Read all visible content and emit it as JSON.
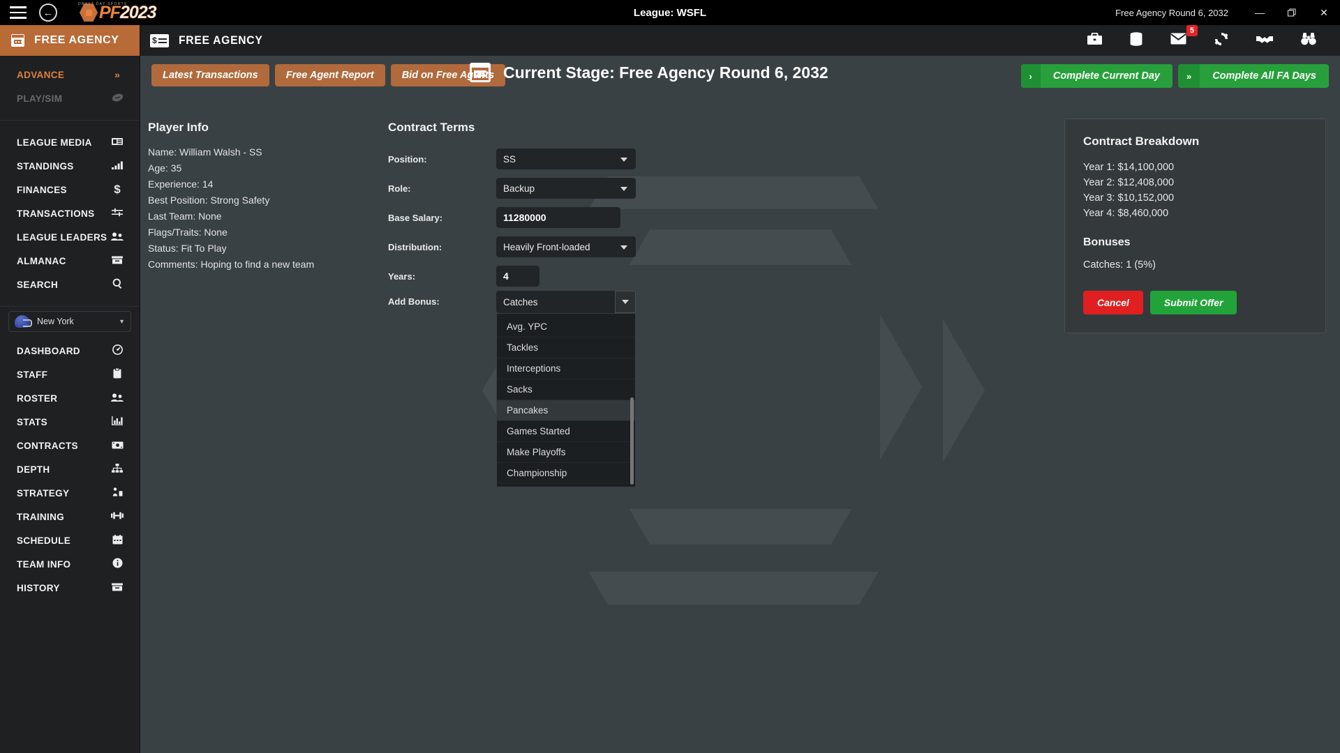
{
  "titlebar": {
    "menu_icon": "hamburger-icon",
    "back_icon": "back-arrow-icon",
    "logo_pf": "PF",
    "logo_year": "2023",
    "logo_tagline": "DRAFT DAY SPORTS",
    "league_title": "League: WSFL",
    "document_title": "Free Agency Round 6, 2032",
    "minimize": "—",
    "restore": "❐",
    "close": "✕"
  },
  "sidebar": {
    "header": {
      "label": "FREE AGENCY",
      "icon": "calendar-icon"
    },
    "advance": {
      "label": "ADVANCE",
      "glyph": "»"
    },
    "playsim": {
      "label": "PLAY/SIM",
      "icon": "football-icon"
    },
    "league_items": [
      {
        "label": "LEAGUE MEDIA",
        "icon": "newspaper-icon"
      },
      {
        "label": "STANDINGS",
        "icon": "bar-chart-icon"
      },
      {
        "label": "FINANCES",
        "icon": "dollar-icon",
        "glyph": "$"
      },
      {
        "label": "TRANSACTIONS",
        "icon": "exchange-icon"
      },
      {
        "label": "LEAGUE LEADERS",
        "icon": "people-icon"
      },
      {
        "label": "ALMANAC",
        "icon": "archive-icon"
      },
      {
        "label": "SEARCH",
        "icon": "search-icon"
      }
    ],
    "team": {
      "name": "New York",
      "icon": "helmet-icon",
      "caret": "▼"
    },
    "team_items": [
      {
        "label": "DASHBOARD",
        "icon": "speedometer-icon"
      },
      {
        "label": "STAFF",
        "icon": "clipboard-icon"
      },
      {
        "label": "ROSTER",
        "icon": "people-icon"
      },
      {
        "label": "STATS",
        "icon": "chart-icon"
      },
      {
        "label": "CONTRACTS",
        "icon": "money-icon"
      },
      {
        "label": "DEPTH",
        "icon": "hierarchy-icon"
      },
      {
        "label": "STRATEGY",
        "icon": "chess-icon"
      },
      {
        "label": "TRAINING",
        "icon": "dumbbell-icon"
      },
      {
        "label": "SCHEDULE",
        "icon": "calendar-icon"
      },
      {
        "label": "TEAM INFO",
        "icon": "info-icon"
      },
      {
        "label": "HISTORY",
        "icon": "archive-icon"
      }
    ]
  },
  "appbar": {
    "title": "FREE AGENCY",
    "title_icon": "check-dollar-icon",
    "icons": [
      {
        "name": "briefcase-icon"
      },
      {
        "name": "database-icon"
      },
      {
        "name": "mail-icon",
        "badge": "5"
      },
      {
        "name": "refresh-icon"
      },
      {
        "name": "handshake-icon"
      },
      {
        "name": "binoculars-icon"
      }
    ]
  },
  "toolbar": {
    "tabs": [
      {
        "label": "Latest Transactions"
      },
      {
        "label": "Free Agent Report"
      },
      {
        "label": "Bid on Free Agents"
      }
    ],
    "stage_icon": "calendar-icon",
    "stage_text": "Current Stage: Free Agency Round 6, 2032",
    "actions": [
      {
        "chevron": "›",
        "label": "Complete Current Day"
      },
      {
        "chevron": "»",
        "label": "Complete All FA Days"
      }
    ]
  },
  "player_info": {
    "heading": "Player Info",
    "lines": [
      "Name: William Walsh - SS",
      "Age: 35",
      "Experience: 14",
      "Best Position: Strong Safety",
      "Last Team: None",
      "Flags/Traits: None",
      "Status: Fit To Play",
      "Comments: Hoping to find a new team"
    ]
  },
  "contract_terms": {
    "heading": "Contract Terms",
    "fields": {
      "position": {
        "label": "Position:",
        "value": "SS"
      },
      "role": {
        "label": "Role:",
        "value": "Backup"
      },
      "base_salary": {
        "label": "Base Salary:",
        "value": "11280000"
      },
      "distribution": {
        "label": "Distribution:",
        "value": "Heavily Front-loaded"
      },
      "years": {
        "label": "Years:",
        "value": "4"
      },
      "add_bonus": {
        "label": "Add Bonus:",
        "value": "Catches"
      }
    },
    "bonus_dropdown": {
      "open": true,
      "highlighted": "Pancakes",
      "options": [
        "Avg. YPC",
        "Tackles",
        "Interceptions",
        "Sacks",
        "Pancakes",
        "Games Started",
        "Make Playoffs",
        "Championship"
      ]
    }
  },
  "breakdown": {
    "heading": "Contract Breakdown",
    "years": [
      "Year 1: $14,100,000",
      "Year 2: $12,408,000",
      "Year 3: $10,152,000",
      "Year 4: $8,460,000"
    ],
    "bonuses_heading": "Bonuses",
    "bonuses": [
      "Catches: 1 (5%)"
    ],
    "cancel_label": "Cancel",
    "submit_label": "Submit Offer"
  },
  "colors": {
    "accent_orange": "#b06a3c",
    "green": "#27a03c",
    "red": "#e02020",
    "sidebar_bg": "#1e2022",
    "content_bg": "#3a4145"
  }
}
